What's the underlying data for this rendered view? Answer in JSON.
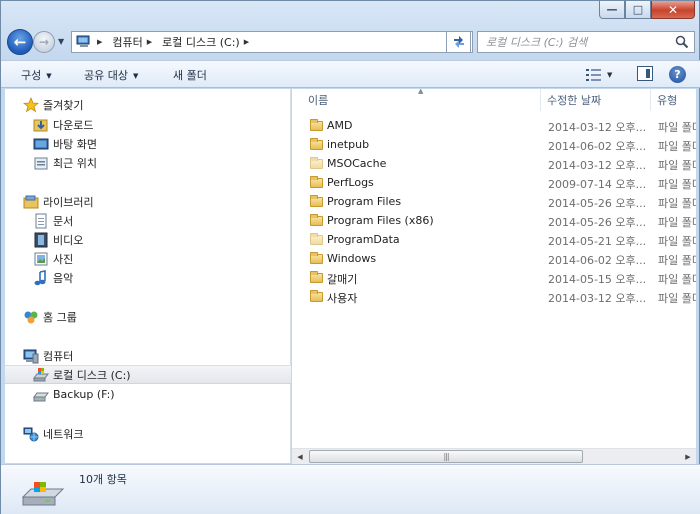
{
  "titlebar": {
    "ghost_text": "",
    "minimize_glyph": "—",
    "maximize_glyph": "□",
    "close_glyph": "✕"
  },
  "address": {
    "segments": [
      "컴퓨터",
      "로컬 디스크 (C:)"
    ]
  },
  "search": {
    "placeholder": "로컬 디스크 (C:) 검색"
  },
  "toolbar": {
    "organize": "구성",
    "share": "공유 대상",
    "new_folder": "새 폴더"
  },
  "nav": {
    "favorites": "즐겨찾기",
    "downloads": "다운로드",
    "desktop": "바탕 화면",
    "recent": "최근 위치",
    "libraries": "라이브러리",
    "documents": "문서",
    "videos": "비디오",
    "pictures": "사진",
    "music": "음악",
    "homegroup": "홈 그룹",
    "computer": "컴퓨터",
    "local_disk": "로컬 디스크 (C:)",
    "backup": "Backup (F:)",
    "network": "네트워크"
  },
  "columns": {
    "name": "이름",
    "date": "수정한 날짜",
    "type": "유형"
  },
  "files": [
    {
      "name": "AMD",
      "date": "2014-03-12 오후...",
      "type": "파일 폴더"
    },
    {
      "name": "inetpub",
      "date": "2014-06-02 오후...",
      "type": "파일 폴더"
    },
    {
      "name": "MSOCache",
      "date": "2014-03-12 오후...",
      "type": "파일 폴더"
    },
    {
      "name": "PerfLogs",
      "date": "2009-07-14 오후...",
      "type": "파일 폴더"
    },
    {
      "name": "Program Files",
      "date": "2014-05-26 오후...",
      "type": "파일 폴더"
    },
    {
      "name": "Program Files (x86)",
      "date": "2014-05-26 오후...",
      "type": "파일 폴더"
    },
    {
      "name": "ProgramData",
      "date": "2014-05-21 오후...",
      "type": "파일 폴더"
    },
    {
      "name": "Windows",
      "date": "2014-06-02 오후...",
      "type": "파일 폴더"
    },
    {
      "name": "갈매기",
      "date": "2014-05-15 오후...",
      "type": "파일 폴더"
    },
    {
      "name": "사용자",
      "date": "2014-03-12 오후...",
      "type": "파일 폴더"
    }
  ],
  "status": {
    "item_count": "10개 항목"
  },
  "colors": {
    "accent": "#1d5bb8",
    "frame": "#c3d7ee"
  }
}
